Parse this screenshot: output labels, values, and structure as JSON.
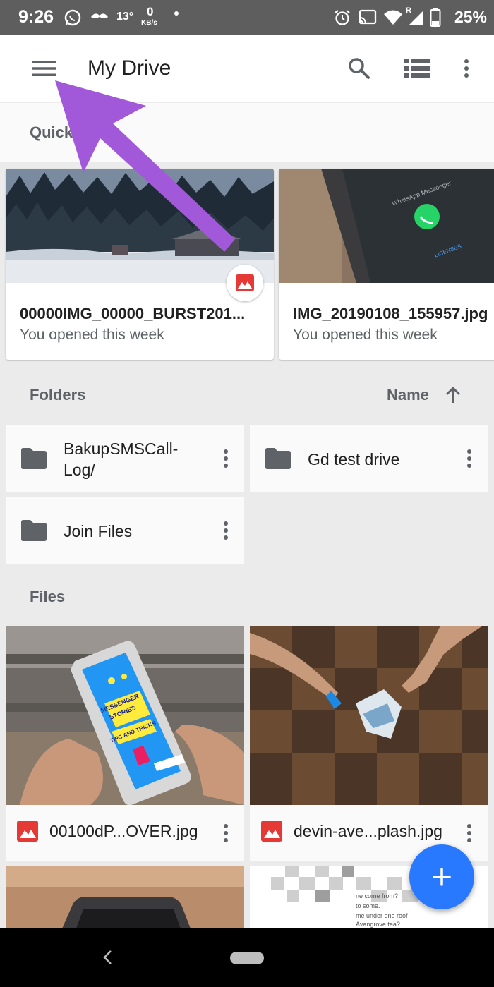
{
  "status_bar": {
    "time": "9:26",
    "temperature": "13°",
    "net_speed_value": "0",
    "net_speed_unit": "KB/s",
    "network_type": "R",
    "battery_percent": "25%",
    "icons": [
      "whatsapp-icon",
      "mustache-icon",
      "alarm-icon",
      "cast-icon",
      "wifi-icon",
      "signal-icon",
      "battery-icon"
    ]
  },
  "app_bar": {
    "title": "My Drive",
    "icons": [
      "menu-icon",
      "search-icon",
      "list-view-icon",
      "more-vert-icon"
    ]
  },
  "quick_access": {
    "label": "Quick",
    "cards": [
      {
        "name": "00000IMG_00000_BURST201...",
        "subtitle": "You opened this week",
        "badge_icon": "image-icon"
      },
      {
        "name": "IMG_20190108_155957.jpg",
        "subtitle": "You opened this week"
      }
    ]
  },
  "folders": {
    "label": "Folders",
    "sort_label": "Name",
    "sort_icon": "arrow-up-icon",
    "items": [
      {
        "name_line1": "BakupSMSCall-",
        "name_line2": "Log/"
      },
      {
        "name_line1": "Gd test drive",
        "name_line2": ""
      },
      {
        "name_line1": "Join Files",
        "name_line2": ""
      }
    ]
  },
  "files": {
    "label": "Files",
    "items": [
      {
        "name": "00100dP...OVER.jpg"
      },
      {
        "name": "devin-ave...plash.jpg"
      }
    ],
    "thumbnail_text": {
      "phone_line1": "MESSENGER",
      "phone_line2": "STORIES",
      "phone_line3": "TIPS AND TRICKS",
      "doc_lines": [
        "ne come from?",
        "to some.",
        "me under one roof",
        "Avangrove tea?"
      ]
    },
    "whatsapp_screen": {
      "title": "WhatsApp Messenger",
      "licenses": "LICENSES"
    }
  },
  "colors": {
    "accent_blue": "#2979ff",
    "image_red": "#e53935",
    "annotation_purple": "#a259d9",
    "folder_gray": "#5f6368"
  }
}
